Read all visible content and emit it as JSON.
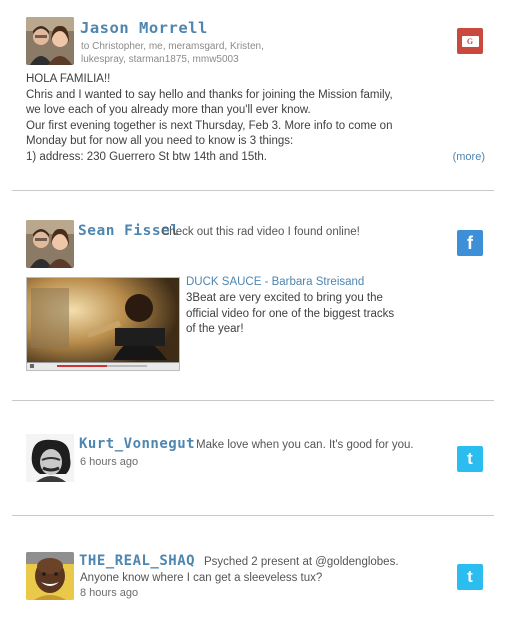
{
  "posts": [
    {
      "author": "Jason Morrell",
      "recipients": "to Christopher, me, meramsgard, Kristen, lukespray, starman1875, mmw5003",
      "body_lines": [
        "HOLA FAMILIA!!",
        "Chris and I wanted to say hello and thanks for joining the Mission family,",
        "we love each of you already more than you'll ever know.",
        "Our first evening together is next Thursday, Feb 3. More info to come on",
        "Monday but for now all you need to know is 3 things:",
        "1) address: 230 Guerrero St btw 14th and 15th."
      ],
      "more_label": "(more)",
      "service": "gmail",
      "service_glyph": "G",
      "service_color": "#c9493f"
    },
    {
      "author": "Sean Fissel",
      "message": "Check out this rad video I found online!",
      "video": {
        "title": "DUCK SAUCE - Barbara Streisand",
        "description": "3Beat are very excited to bring you the official video for one of the biggest tracks of the year!"
      },
      "service": "facebook",
      "service_glyph": "f",
      "service_color": "#3d8fd7"
    },
    {
      "author": "Kurt_Vonnegut",
      "message": "Make love when you can. It's good for you.",
      "timestamp": "6 hours ago",
      "service": "twitter",
      "service_glyph": "t",
      "service_color": "#2bbdf0"
    },
    {
      "author": "THE_REAL_SHAQ",
      "message_line1": "Psyched 2 present at @goldenglobes.",
      "message_line2": "Anyone know where I can get a sleeveless tux?",
      "timestamp": "8 hours ago",
      "service": "twitter",
      "service_glyph": "t",
      "service_color": "#2bbdf0"
    }
  ]
}
